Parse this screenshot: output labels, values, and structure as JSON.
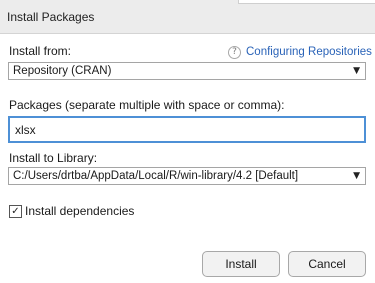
{
  "window": {
    "title": "Install Packages"
  },
  "install_from": {
    "label": "Install from:",
    "value": "Repository (CRAN)",
    "help_icon": "question-circle-icon",
    "help_link": "Configuring Repositories"
  },
  "packages": {
    "label": "Packages (separate multiple with space or comma):",
    "value": "xlsx"
  },
  "library": {
    "label": "Install to Library:",
    "value": "C:/Users/drtba/AppData/Local/R/win-library/4.2 [Default]"
  },
  "dependencies": {
    "label": "Install dependencies",
    "checked": true,
    "check_glyph": "✓"
  },
  "buttons": {
    "install": "Install",
    "cancel": "Cancel"
  },
  "colors": {
    "link": "#2a63b8",
    "focus_border": "#4d90d6",
    "titlebar_bg": "#ececec"
  }
}
